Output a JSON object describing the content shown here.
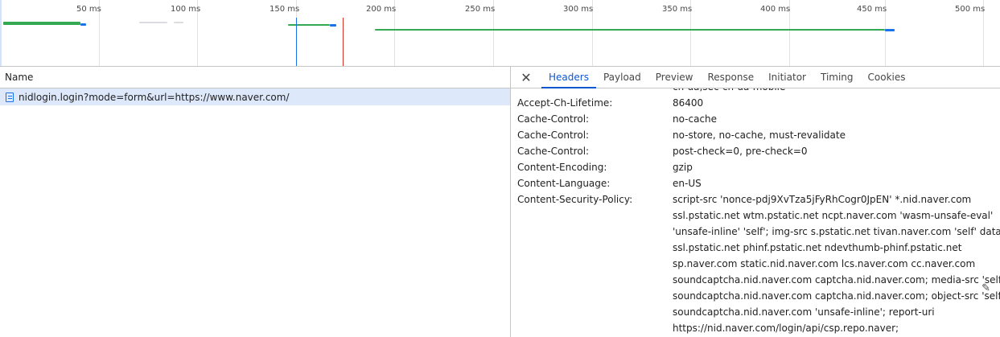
{
  "timeline": {
    "ticks": [
      "50 ms",
      "100 ms",
      "150 ms",
      "200 ms",
      "250 ms",
      "300 ms",
      "350 ms",
      "400 ms",
      "450 ms",
      "500 ms"
    ]
  },
  "request_list": {
    "column_header": "Name",
    "rows": [
      {
        "name": "nidlogin.login?mode=form&url=https://www.naver.com/",
        "icon": "document-icon",
        "selected": true
      }
    ]
  },
  "details": {
    "tabs": [
      {
        "label": "Headers",
        "active": true
      },
      {
        "label": "Payload",
        "active": false
      },
      {
        "label": "Preview",
        "active": false
      },
      {
        "label": "Response",
        "active": false
      },
      {
        "label": "Initiator",
        "active": false
      },
      {
        "label": "Timing",
        "active": false
      },
      {
        "label": "Cookies",
        "active": false
      }
    ],
    "partial_value_above": "ch-ua,sec-ch-ua-mobile",
    "headers": [
      {
        "name": "Accept-Ch-Lifetime:",
        "value": [
          "86400"
        ]
      },
      {
        "name": "Cache-Control:",
        "value": [
          "no-cache"
        ]
      },
      {
        "name": "Cache-Control:",
        "value": [
          "no-store, no-cache, must-revalidate"
        ]
      },
      {
        "name": "Cache-Control:",
        "value": [
          "post-check=0, pre-check=0"
        ]
      },
      {
        "name": "Content-Encoding:",
        "value": [
          "gzip"
        ]
      },
      {
        "name": "Content-Language:",
        "value": [
          "en-US"
        ]
      },
      {
        "name": "Content-Security-Policy:",
        "value": [
          "script-src 'nonce-pdj9XvTza5jFyRhCogr0JpEN' *.nid.naver.com",
          "ssl.pstatic.net wtm.pstatic.net ncpt.naver.com 'wasm-unsafe-eval'",
          "'unsafe-inline' 'self'; img-src s.pstatic.net tivan.naver.com 'self' data:",
          "ssl.pstatic.net phinf.pstatic.net ndevthumb-phinf.pstatic.net",
          "sp.naver.com static.nid.naver.com lcs.naver.com cc.naver.com",
          "soundcaptcha.nid.naver.com captcha.nid.naver.com; media-src 'self'",
          "soundcaptcha.nid.naver.com captcha.nid.naver.com; object-src 'self'",
          "soundcaptcha.nid.naver.com 'unsafe-inline'; report-uri",
          "https://nid.naver.com/login/api/csp.repo.naver;"
        ]
      }
    ],
    "edit_icon": "pencil-icon"
  },
  "colors": {
    "accent": "#0b57d0",
    "selected_row": "#dde8fb",
    "timeline_green": "#34a853",
    "timeline_blue": "#1a73e8",
    "timeline_red": "#d93025"
  }
}
